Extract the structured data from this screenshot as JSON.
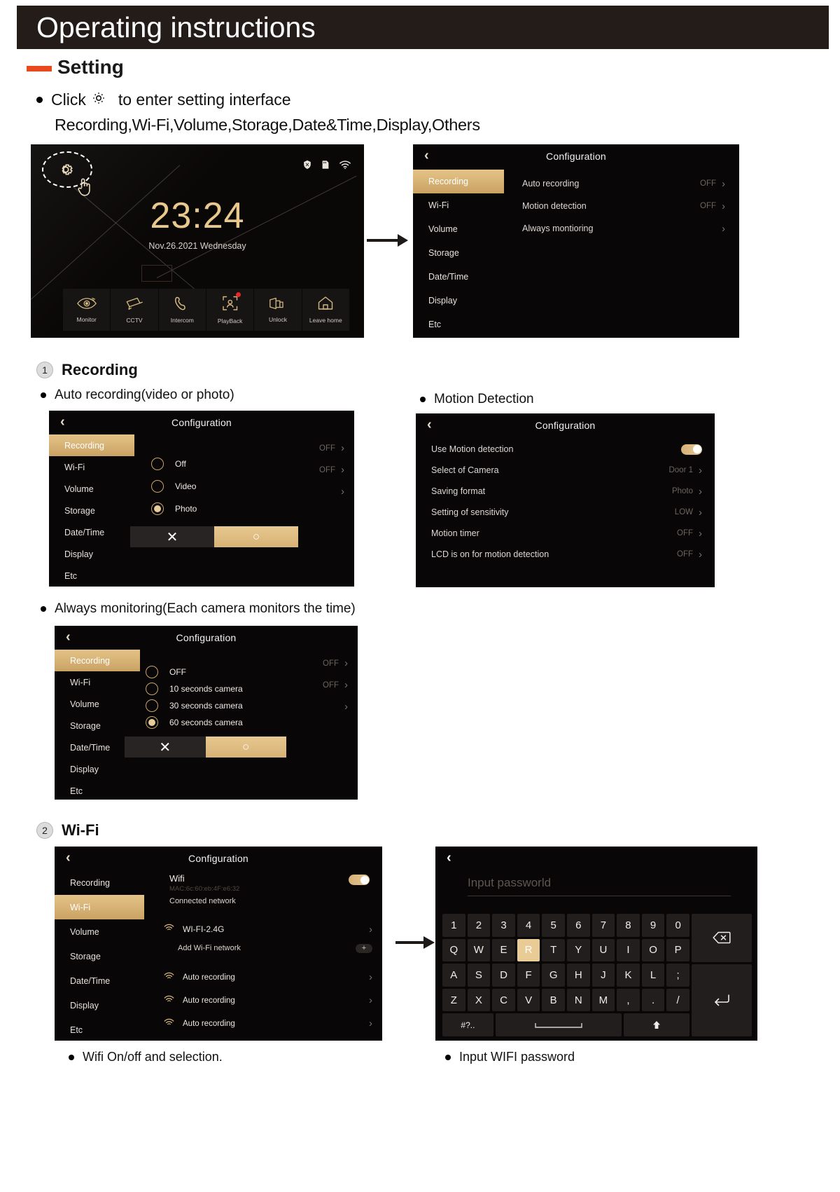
{
  "header": {
    "title": "Operating instructions"
  },
  "setting": {
    "title": "Setting",
    "bullet1_pre": "Click",
    "bullet1_post": "to enter setting interface",
    "bullet2": "Recording,Wi-Fi,Volume,Storage,Date&Time,Display,Others",
    "gear_icon": "gear-icon"
  },
  "colors": {
    "accent_gold": "#d8b276",
    "orange": "#e8491d",
    "dark": "#231c19",
    "screen_bg": "#080606",
    "red_dot": "#e8262a"
  },
  "home_screen": {
    "time": "23:24",
    "date": "Nov.26.2021  Wednesday",
    "status_icons": [
      "alarm-off-icon",
      "sd-card-icon",
      "wifi-icon"
    ],
    "gear_icon": "gear-icon",
    "hand_icon": "hand-tap-icon",
    "nav": [
      {
        "label": "Monitor",
        "icon": "eye-icon"
      },
      {
        "label": "CCTV",
        "icon": "cctv-camera-icon"
      },
      {
        "label": "Intercom",
        "icon": "phone-handset-icon"
      },
      {
        "label": "PlayBack",
        "icon": "person-frame-icon",
        "badge": true
      },
      {
        "label": "Unlock",
        "icon": "door-icon"
      },
      {
        "label": "Leave home",
        "icon": "home-icon"
      }
    ]
  },
  "config_main": {
    "title": "Configuration",
    "sidebar": [
      "Recording",
      "Wi-Fi",
      "Volume",
      "Storage",
      "Date/Time",
      "Display",
      "Etc"
    ],
    "active_index": 0,
    "rows": [
      {
        "label": "Auto recording",
        "value": "OFF"
      },
      {
        "label": "Motion detection",
        "value": "OFF"
      },
      {
        "label": "Always montioring",
        "value": ""
      }
    ]
  },
  "section1": {
    "number": "1",
    "title": "Recording",
    "caption_auto": "Auto recording(video or photo)",
    "caption_motion": "Motion Detection",
    "caption_always": "Always monitoring(Each camera monitors the time)"
  },
  "auto_recording_panel": {
    "title": "Configuration",
    "sidebar": [
      "Recording",
      "Wi-Fi",
      "Volume",
      "Storage",
      "Date/Time",
      "Display",
      "Etc"
    ],
    "active_index": 0,
    "ghost_values": [
      "OFF",
      "OFF",
      ""
    ],
    "options": [
      {
        "label": "Off",
        "selected": false
      },
      {
        "label": "Video",
        "selected": false
      },
      {
        "label": "Photo",
        "selected": true
      }
    ],
    "cancel_glyph": "✕",
    "confirm_glyph": "○"
  },
  "motion_panel": {
    "title": "Configuration",
    "rows": [
      {
        "label": "Use Motion detection",
        "value": "",
        "toggle": true
      },
      {
        "label": "Select of Camera",
        "value": "Door 1"
      },
      {
        "label": "Saving format",
        "value": "Photo"
      },
      {
        "label": "Setting of sensitivity",
        "value": "LOW"
      },
      {
        "label": "Motion timer",
        "value": "OFF"
      },
      {
        "label": "LCD is on for motion detection",
        "value": "OFF"
      }
    ]
  },
  "always_panel": {
    "title": "Configuration",
    "sidebar": [
      "Recording",
      "Wi-Fi",
      "Volume",
      "Storage",
      "Date/Time",
      "Display",
      "Etc"
    ],
    "active_index": 0,
    "ghost_values": [
      "OFF",
      "OFF",
      ""
    ],
    "options": [
      {
        "label": "OFF",
        "selected": false
      },
      {
        "label": "10 seconds camera",
        "selected": false
      },
      {
        "label": "30 seconds camera",
        "selected": false
      },
      {
        "label": "60 seconds camera",
        "selected": true
      }
    ],
    "cancel_glyph": "✕",
    "confirm_glyph": "○"
  },
  "section2": {
    "number": "2",
    "title": "Wi-Fi",
    "caption_left": "Wifi  On/off and selection.",
    "caption_right": "Input WIFI password"
  },
  "wifi_panel": {
    "title": "Configuration",
    "sidebar": [
      "Recording",
      "Wi-Fi",
      "Volume",
      "Storage",
      "Date/Time",
      "Display",
      "Etc"
    ],
    "active_index": 1,
    "wifi_label": "Wifi",
    "mac": "MAC:6c:60:eb:4F:e6:32",
    "connected_label": "Connected network",
    "networks": [
      {
        "name": "WI-FI-2.4G",
        "icon": "wifi-icon"
      },
      {
        "name": "Auto recording",
        "icon": "wifi-icon"
      },
      {
        "name": "Auto recording",
        "icon": "wifi-icon"
      },
      {
        "name": "Auto recording",
        "icon": "wifi-icon"
      }
    ],
    "add_network_label": "Add  Wi-Fi network",
    "add_glyph": "+"
  },
  "keyboard_panel": {
    "placeholder": "Input passworld",
    "row_num": [
      "1",
      "2",
      "3",
      "4",
      "5",
      "6",
      "7",
      "8",
      "9",
      "0"
    ],
    "row_q": [
      "Q",
      "W",
      "E",
      "R",
      "T",
      "Y",
      "U",
      "I",
      "O",
      "P"
    ],
    "row_a": [
      "A",
      "S",
      "D",
      "F",
      "G",
      "H",
      "J",
      "K",
      "L",
      ";"
    ],
    "row_z": [
      "Z",
      "X",
      "C",
      "V",
      "B",
      "N",
      "M",
      ",",
      ".",
      "/"
    ],
    "highlight_key": "R",
    "symbols_key": "#?..",
    "backspace_icon": "backspace-icon",
    "enter_icon": "enter-icon",
    "shift_icon": "shift-up-icon",
    "space_icon": "space-bar-icon"
  }
}
